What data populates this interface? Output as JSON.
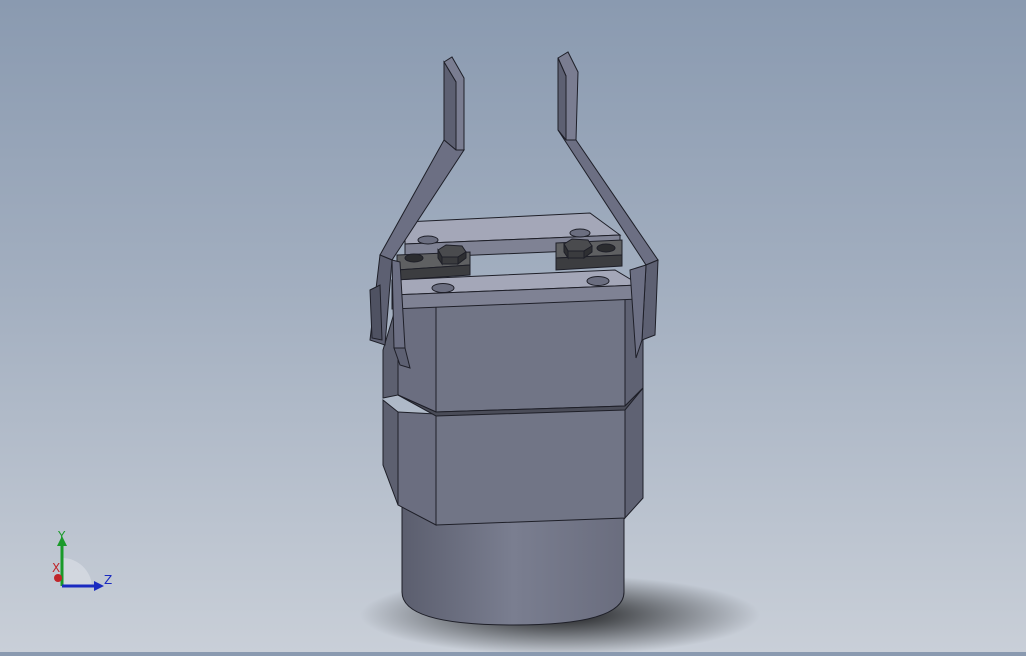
{
  "view": {
    "colors": {
      "background_top": "#8a9ab0",
      "background_bottom": "#c9cfd8",
      "body_face": "#717586",
      "body_side": "#5d6070",
      "plate_top": "#a4a7b8",
      "finger": "#6c6f83",
      "bolt": "#3c3d40",
      "edge": "#1e1f28"
    }
  },
  "triad": {
    "x_label": "X",
    "y_label": "Y",
    "z_label": "Z",
    "colors": {
      "x": "#c0262a",
      "y": "#1a9a2a",
      "z": "#1a2ac0"
    }
  }
}
